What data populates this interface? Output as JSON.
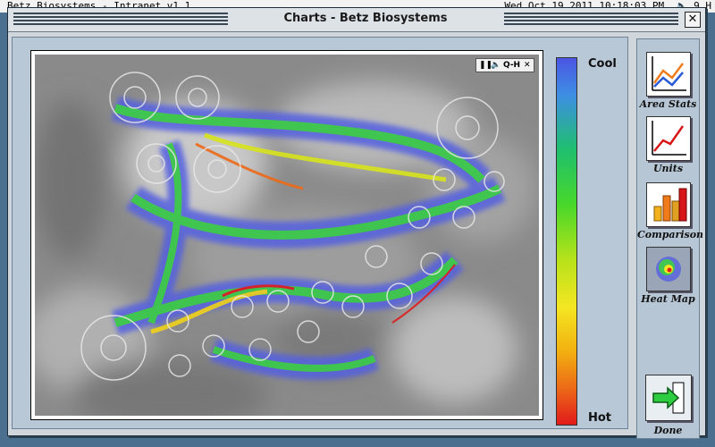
{
  "menubar": {
    "app_title": "Betz Biosystems - Intranet v1.1",
    "datetime": "Wed Oct 19 2011 10:18:03 PM",
    "volume_icon": "speaker-icon",
    "user": "9 H"
  },
  "window": {
    "title": "Charts - Betz Biosystems",
    "close_label": "✕"
  },
  "media_controls": {
    "pause_label": "❚❚",
    "volume_label": "🔈",
    "quality_label": "Q-H",
    "close_label": "✕"
  },
  "legend": {
    "top_label": "Cool",
    "bottom_label": "Hot",
    "colors": [
      "#4b55e2",
      "#3e8ee4",
      "#1fbf6e",
      "#48d82a",
      "#b7e21a",
      "#f4e622",
      "#f2b010",
      "#ec6a18",
      "#e11a1a"
    ]
  },
  "sidebar": {
    "tools": [
      {
        "label": "Area Stats",
        "icon": "line-chart-icon"
      },
      {
        "label": "Units",
        "icon": "rising-line-chart-icon"
      },
      {
        "label": "Comparison",
        "icon": "bar-chart-icon"
      },
      {
        "label": "Heat Map",
        "icon": "heat-map-icon"
      }
    ],
    "done_label": "Done",
    "done_icon": "arrow-right-icon"
  }
}
